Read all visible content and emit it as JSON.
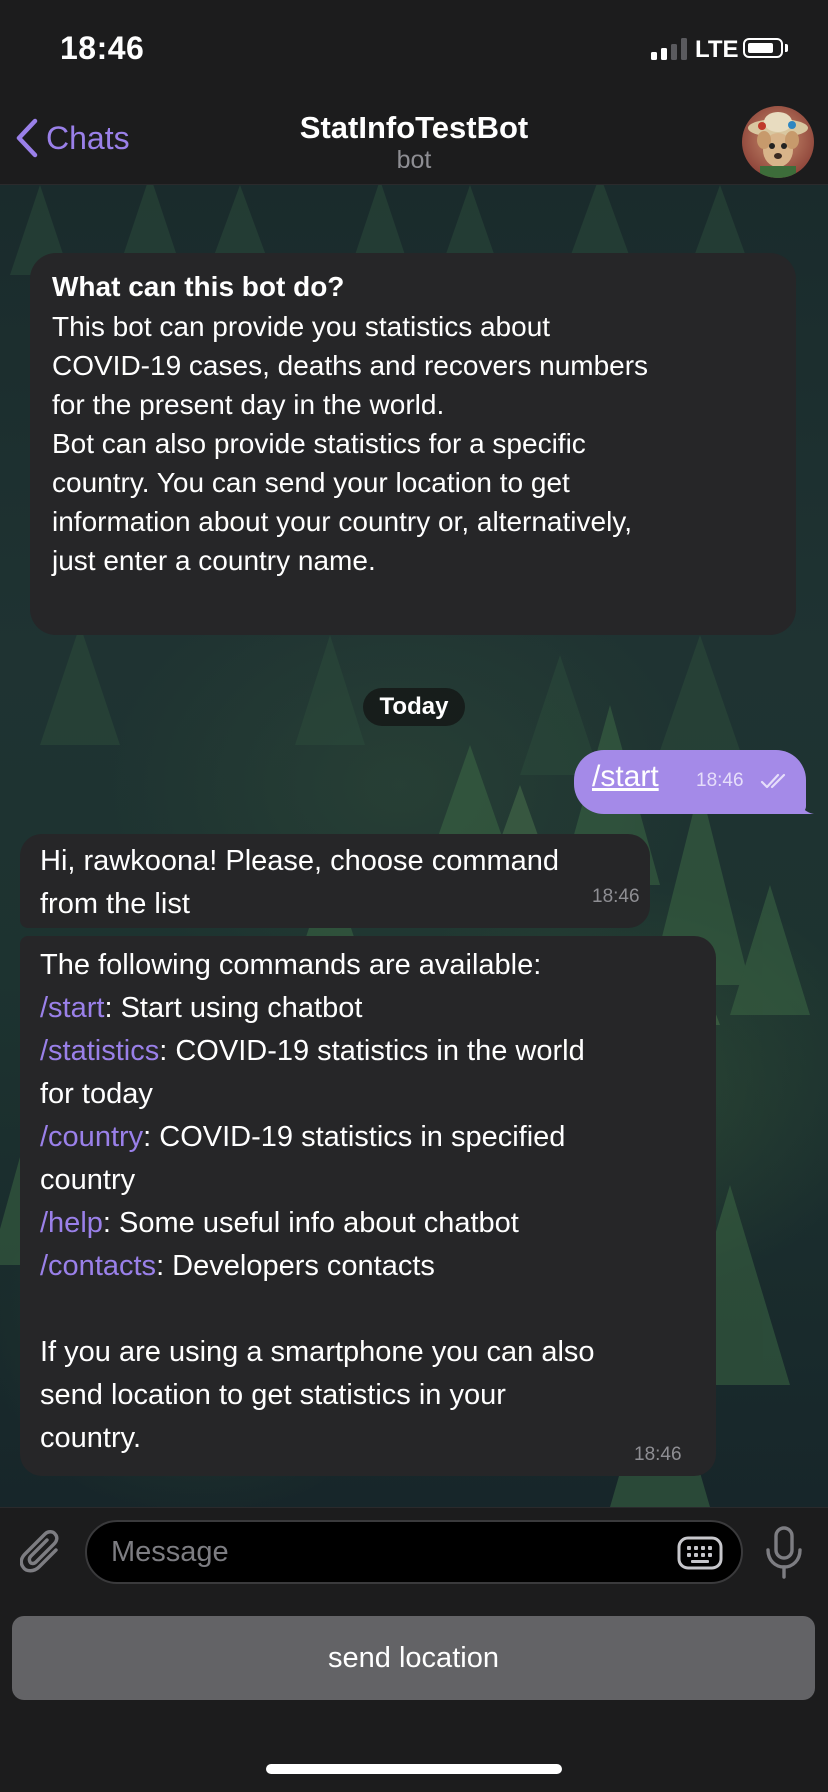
{
  "status_bar": {
    "time": "18:46",
    "network": "LTE",
    "signal_bars_active": 2,
    "battery_level": 0.85
  },
  "header": {
    "back_label": "Chats",
    "title": "StatInfoTestBot",
    "subtitle": "bot"
  },
  "info_card": {
    "title": "What can this bot do?",
    "body": "This bot can provide you statistics about\nCOVID-19 cases, deaths and recovers numbers\nfor the present day in the world.\nBot can also provide statistics for a specific\ncountry. You can send your location to get\ninformation about your country or, alternatively,\njust enter a country name."
  },
  "date_separator": "Today",
  "outgoing": {
    "text": "/start",
    "time": "18:46",
    "status": "read"
  },
  "greeting": {
    "text": "Hi, rawkoona! Please, choose command\nfrom the list",
    "time": "18:46"
  },
  "commands_message": {
    "intro": "The following commands are available:",
    "commands": [
      {
        "command": "/start",
        "desc": ": Start using chatbot"
      },
      {
        "command": "/statistics",
        "desc": ": COVID-19 statistics in the world\nfor today"
      },
      {
        "command": "/country",
        "desc": ": COVID-19 statistics in specified\ncountry"
      },
      {
        "command": "/help",
        "desc": ": Some useful info about chatbot"
      },
      {
        "command": "/contacts",
        "desc": ": Developers contacts"
      }
    ],
    "footer": "If you are using a smartphone you can also\nsend location to get statistics in your\ncountry.",
    "time": "18:46"
  },
  "composer": {
    "placeholder": "Message"
  },
  "keyboard_button": {
    "label": "send location"
  },
  "colors": {
    "accent": "#9a80e9",
    "outgoing_bubble": "#a48ae8",
    "incoming_bubble": "#262628",
    "bar_background": "#1c1c1d"
  }
}
